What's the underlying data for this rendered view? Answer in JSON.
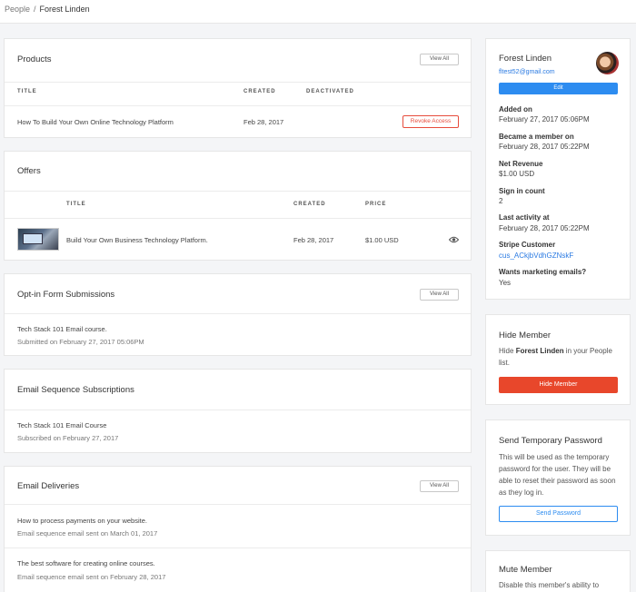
{
  "breadcrumb": {
    "parent": "People",
    "separator": "/",
    "current": "Forest Linden"
  },
  "products": {
    "title": "Products",
    "view_all": "View All",
    "headers": {
      "title": "TITLE",
      "created": "CREATED",
      "deactivated": "DEACTIVATED"
    },
    "rows": [
      {
        "title": "How To Build Your Own Online Technology Platform",
        "created": "Feb 28, 2017",
        "deactivated": "",
        "action": "Revoke Access"
      }
    ]
  },
  "offers": {
    "title": "Offers",
    "headers": {
      "title": "TITLE",
      "created": "CREATED",
      "price": "PRICE"
    },
    "rows": [
      {
        "title": "Build Your Own Business Technology Platform.",
        "created": "Feb 28, 2017",
        "price": "$1.00 USD"
      }
    ]
  },
  "optin": {
    "title": "Opt-in Form Submissions",
    "view_all": "View All",
    "items": [
      {
        "name": "Tech Stack 101 Email course.",
        "detail": "Submitted on February 27, 2017 05:06PM"
      }
    ]
  },
  "sequences": {
    "title": "Email Sequence Subscriptions",
    "items": [
      {
        "name": "Tech Stack 101 Email Course",
        "detail": "Subscribed on February 27, 2017"
      }
    ]
  },
  "deliveries": {
    "title": "Email Deliveries",
    "view_all": "View All",
    "items": [
      {
        "name": "How to process payments on your website.",
        "detail": "Email sequence email sent on March 01, 2017"
      },
      {
        "name": "The best software for creating online courses.",
        "detail": "Email sequence email sent on February 28, 2017"
      }
    ]
  },
  "profile": {
    "name": "Forest Linden",
    "email": "fltest52@gmail.com",
    "edit": "Edit",
    "fields": [
      {
        "label": "Added on",
        "value": "February 27, 2017 05:06PM"
      },
      {
        "label": "Became a member on",
        "value": "February 28, 2017 05:22PM"
      },
      {
        "label": "Net Revenue",
        "value": "$1.00 USD"
      },
      {
        "label": "Sign in count",
        "value": "2"
      },
      {
        "label": "Last activity at",
        "value": "February 28, 2017 05:22PM"
      },
      {
        "label": "Stripe Customer",
        "value": "cus_ACkjbVdhGZNskF"
      },
      {
        "label": "Wants marketing emails?",
        "value": "Yes"
      }
    ]
  },
  "hide_member": {
    "title": "Hide Member",
    "text_before": "Hide ",
    "text_name": "Forest Linden",
    "text_after": " in your People list.",
    "button": "Hide Member"
  },
  "temp_password": {
    "title": "Send Temporary Password",
    "text": "This will be used as the temporary password for the user. They will be able to reset their password as soon as they log in.",
    "button": "Send Password"
  },
  "mute_member": {
    "title": "Mute Member",
    "text": "Disable this member's ability to"
  },
  "colors": {
    "accent": "#2d8cf0",
    "danger": "#e8472b",
    "link": "#2a7ae2"
  }
}
